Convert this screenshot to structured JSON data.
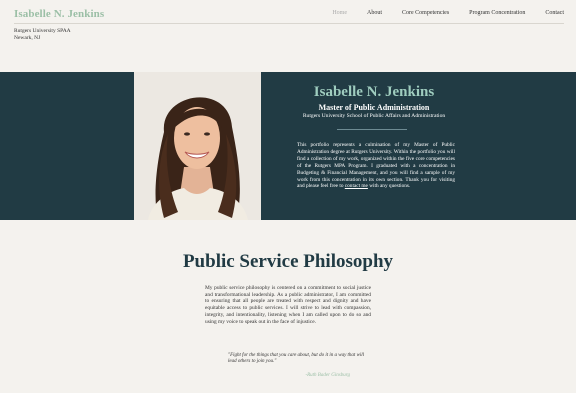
{
  "header": {
    "brand": "Isabelle N. Jenkins",
    "nav": [
      {
        "label": "Home"
      },
      {
        "label": "About"
      },
      {
        "label": "Core Competencies"
      },
      {
        "label": "Program Concentration"
      },
      {
        "label": "Contact"
      }
    ],
    "active_nav": "Home",
    "affiliation_line1": "Rutgers University SPAA",
    "affiliation_line2": "Newark, NJ"
  },
  "hero": {
    "name": "Isabelle N. Jenkins",
    "degree": "Master of Public Administration",
    "school": "Rutgers University School of Public Affairs and Administration",
    "intro_text": "This portfolio represents a culmination of my Master of Public Administration degree at Rutgers University. Within the portfolio you will find a collection of my work, organized within the five core competencies of the Rutgers MPA Program. I graduated with a concentration in Budgeting & Financial Management, and you will find a sample of my work from this concentration in its own section. Thank you for visiting and please feel free to",
    "contact_link": "contact me",
    "intro_tail": " with any questions.",
    "photo_icon": "portrait-photo"
  },
  "philosophy": {
    "title": "Public Service Philosophy",
    "text": "My public service philosophy is centered on a commitment to social justice and transformational leadership. As a public administrator, I am committed to ensuring that all people are treated with respect and dignity and have equitable access to public services. I will strive to lead with compassion, integrity, and intentionality, listening when I am called upon to do so and using my voice to speak out in the face of injustice.",
    "quote": "\"Fight for the things that you care about, but do it in a way that will lead others to join you.\"",
    "quote_author": "-Ruth Bader Ginsburg"
  },
  "colors": {
    "hero_bg": "#213b44",
    "accent_green": "#9bbfa6",
    "hero_title": "#9fcdbf",
    "page_bg": "#f4f2ee"
  }
}
